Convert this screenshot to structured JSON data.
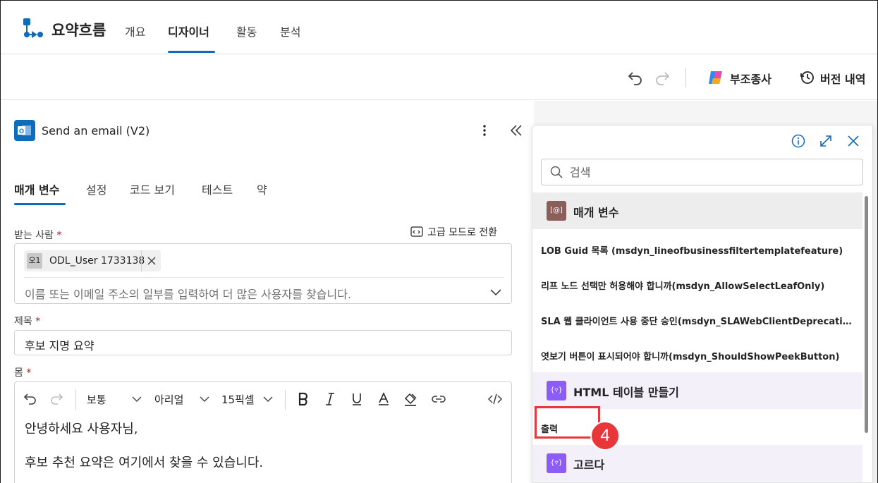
{
  "header": {
    "app_title": "요약흐름",
    "tabs": [
      {
        "label": "개요"
      },
      {
        "label": "디자이너"
      },
      {
        "label": "활동"
      },
      {
        "label": "분석"
      }
    ],
    "active_tab": "디자이너"
  },
  "toolbar": {
    "undo_icon": "undo-icon",
    "redo_icon": "redo-icon",
    "copilot_label": "부조종사",
    "version_history_label": "버전 내역"
  },
  "action_panel": {
    "title": "Send an email (V2)",
    "tabs": [
      {
        "label": "매개 변수"
      },
      {
        "label": "설정"
      },
      {
        "label": "코드 보기"
      },
      {
        "label": "테스트"
      },
      {
        "label": "약"
      }
    ],
    "to": {
      "label": "받는 사람",
      "required_mark": "*",
      "advanced_mode_label": "고급 모드로 전환",
      "chip": {
        "avatar": "오1",
        "text": "ODL_User 1733138"
      },
      "placeholder": "이름 또는 이메일 주소의 일부를 입력하여 더 많은 사용자를 찾습니다."
    },
    "subject": {
      "label": "제목",
      "required_mark": "*",
      "value": "후보 지명 요약"
    },
    "body": {
      "label": "몸",
      "required_mark": "*",
      "toolbar": {
        "paragraph_style": "보통",
        "font": "아리얼",
        "size": "15픽셀"
      },
      "lines": [
        "안녕하세요 사용자님,",
        "후보 추천 요약은 여기에서 찾을 수 있습니다."
      ]
    }
  },
  "dynamic_content": {
    "search_placeholder": "검색",
    "sections": [
      {
        "label": "매개 변수",
        "icon_text": "[@]",
        "color": "#8b5e5a",
        "items": [
          "LOB Guid 목록 (msdyn_lineofbusinessfiltertemplatefeature)",
          "리프 노드 선택만 허용해야 합니까(msdyn_AllowSelectLeafOnly)",
          "SLA 웹 클라이언트 사용 중단 승인(msdyn_SLAWebClientDeprecationAcknowledgement)",
          "엿보기 버튼이 표시되어야 합니까(msdyn_ShouldShowPeekButton)"
        ]
      },
      {
        "label": "HTML 테이블 만들기",
        "icon_text": "{▿}",
        "color": "#8b5cf6",
        "items": [
          "출력"
        ]
      },
      {
        "label": "고르다",
        "icon_text": "{▿}",
        "color": "#8b5cf6",
        "items": []
      }
    ]
  },
  "annotation": {
    "step_number": "4",
    "color": "#e8363b"
  }
}
